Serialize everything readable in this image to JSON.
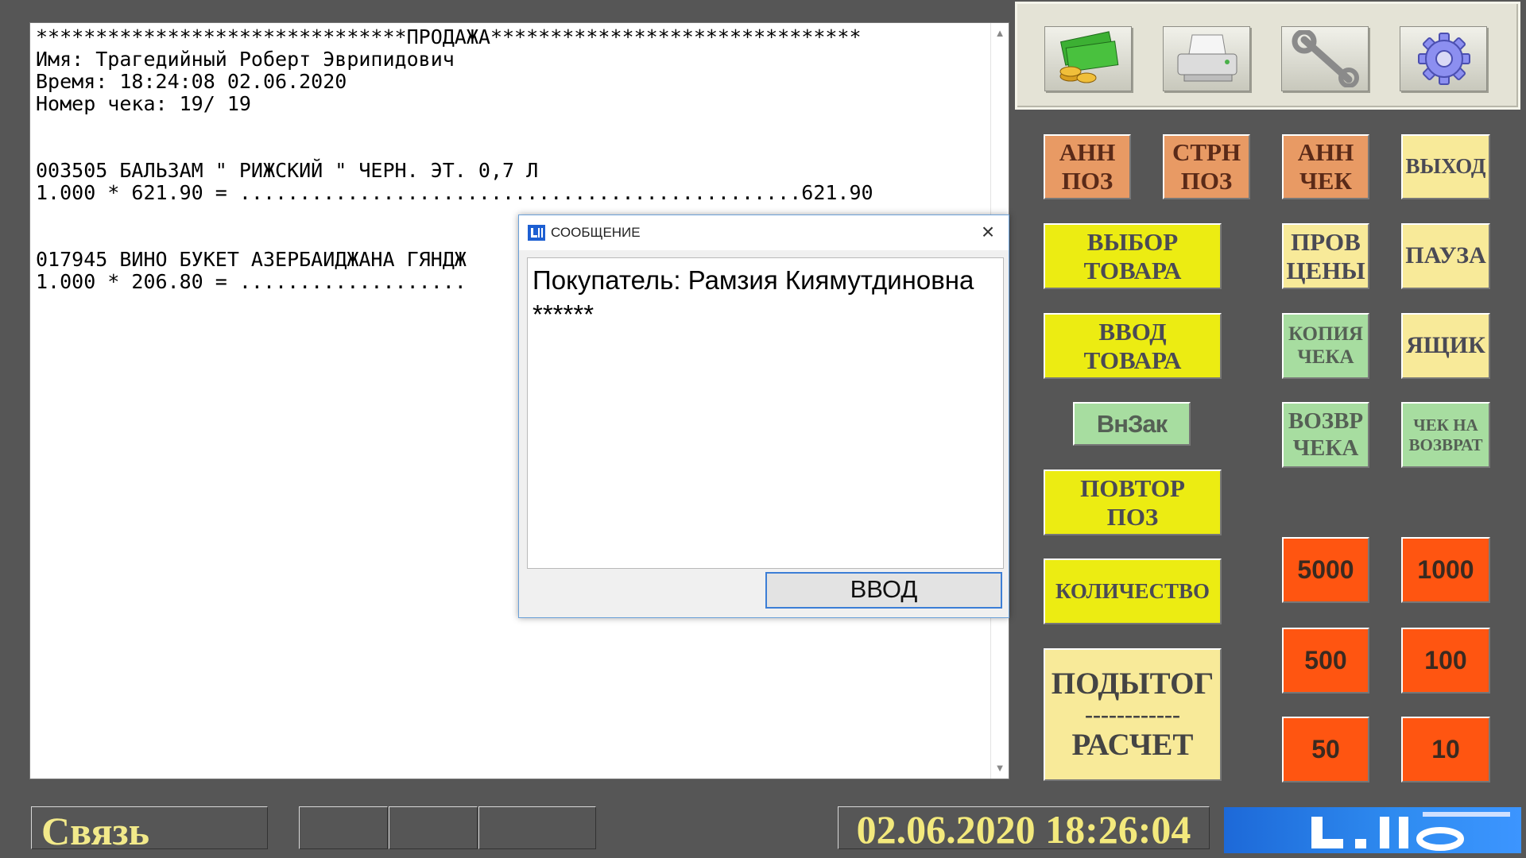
{
  "receipt": {
    "header": "*******************************ПРОДАЖА*******************************",
    "name_line": "Имя: Трагедийный Роберт Эврипидович",
    "time_line": "Время: 18:24:08 02.06.2020",
    "check_line": "Номер чека: 19/ 19",
    "items": [
      {
        "title": "003505 БАЛЬЗАМ \" РИЖСКИЙ \" ЧЕРН. ЭТ. 0,7 Л",
        "calc": "1.000 * 621.90 = ...............................................621.90"
      },
      {
        "title": "017945 ВИНО БУКЕТ АЗЕРБАИДЖАНА ГЯНДЖ",
        "calc": "1.000 * 206.80 = ..................."
      }
    ]
  },
  "toolbar": {
    "icons": [
      "money-icon",
      "printer-icon",
      "wrench-icon",
      "settings-gear-icon"
    ]
  },
  "keys": {
    "ann_poz": "АНН\nПОЗ",
    "strn_poz": "СТРН\nПОЗ",
    "ann_chek": "АНН\nЧЕК",
    "vyhod": "ВЫХОД",
    "vybor_tovara": "ВЫБОР\nТОВАРА",
    "prov_ceny": "ПРОВ\nЦЕНЫ",
    "pauza": "ПАУЗА",
    "vvod_tovara": "ВВОД\nТОВАРА",
    "kopiya_cheka": "КОПИЯ\nЧЕКА",
    "yaschik": "ЯЩИК",
    "vnzak": "ВнЗак",
    "vozvr_cheka": "ВОЗВР\nЧЕКА",
    "chek_na_vozvrat": "ЧЕК НА\nВОЗВРАТ",
    "povtor_poz": "ПОВТОР\nПОЗ",
    "kolichestvo": "КОЛИЧЕСТВО",
    "podytog": "ПОДЫТОГ",
    "podytog_sep": "------------",
    "raschet": "РАСЧЕТ",
    "n5000": "5000",
    "n1000": "1000",
    "n500": "500",
    "n100": "100",
    "n50": "50",
    "n10": "10"
  },
  "status": {
    "connection": "Связь",
    "datetime": "02.06.2020 18:26:04"
  },
  "dialog": {
    "title": "СООБЩЕНИЕ",
    "message": "Покупатель: Рамзия Киямутдиновна ******",
    "ok_label": "ВВОД"
  }
}
